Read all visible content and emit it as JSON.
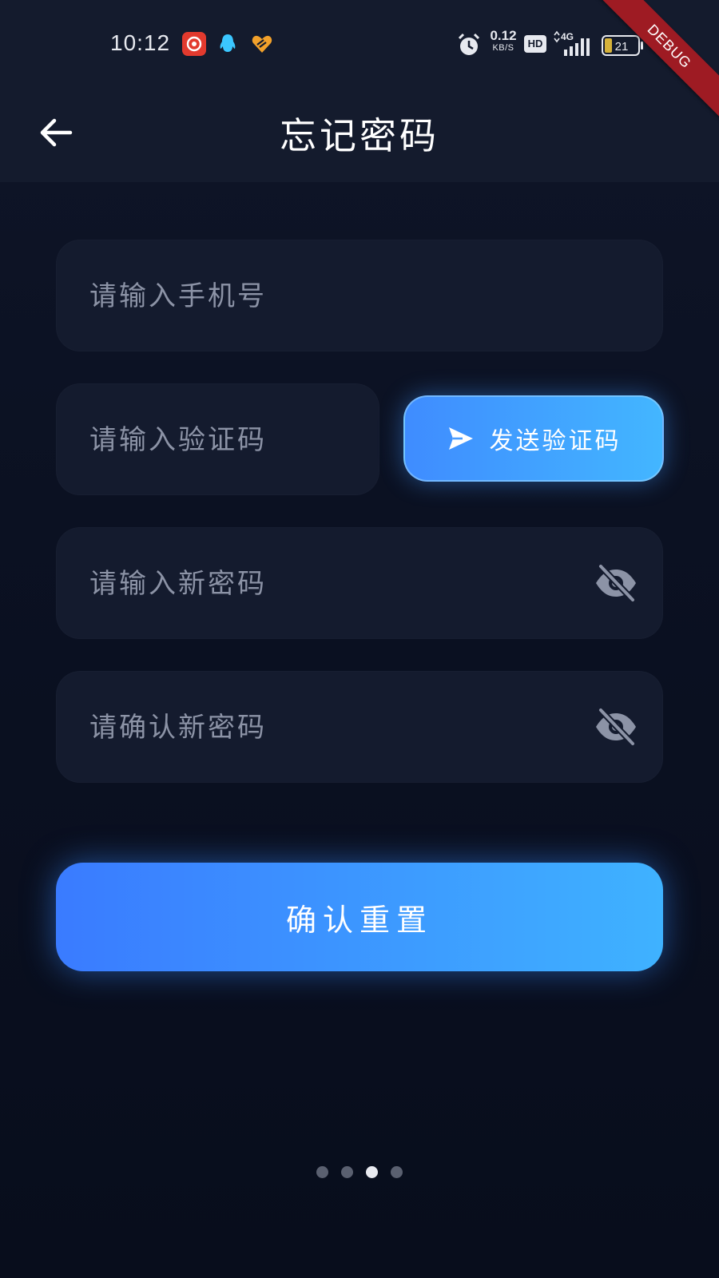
{
  "status_bar": {
    "time": "10:12",
    "net_speed_value": "0.12",
    "net_speed_unit": "KB/S",
    "hd_badge": "HD",
    "network_type": "4G",
    "battery_level": "21",
    "icons": [
      "netease-music-icon",
      "qq-icon",
      "heart-app-icon",
      "alarm-icon",
      "signal-icon",
      "battery-icon"
    ]
  },
  "debug_banner": "DEBUG",
  "header": {
    "title": "忘记密码"
  },
  "form": {
    "phone_placeholder": "请输入手机号",
    "code_placeholder": "请输入验证码",
    "send_code_label": "发送验证码",
    "new_password_placeholder": "请输入新密码",
    "confirm_password_placeholder": "请确认新密码",
    "submit_label": "确认重置"
  },
  "pager": {
    "total": 4,
    "active_index": 2
  },
  "colors": {
    "background": "#0b1122",
    "field": "#141b2e",
    "accent_start": "#3a7bff",
    "accent_end": "#3fb2ff",
    "debug_ribbon": "#9e1b23"
  }
}
